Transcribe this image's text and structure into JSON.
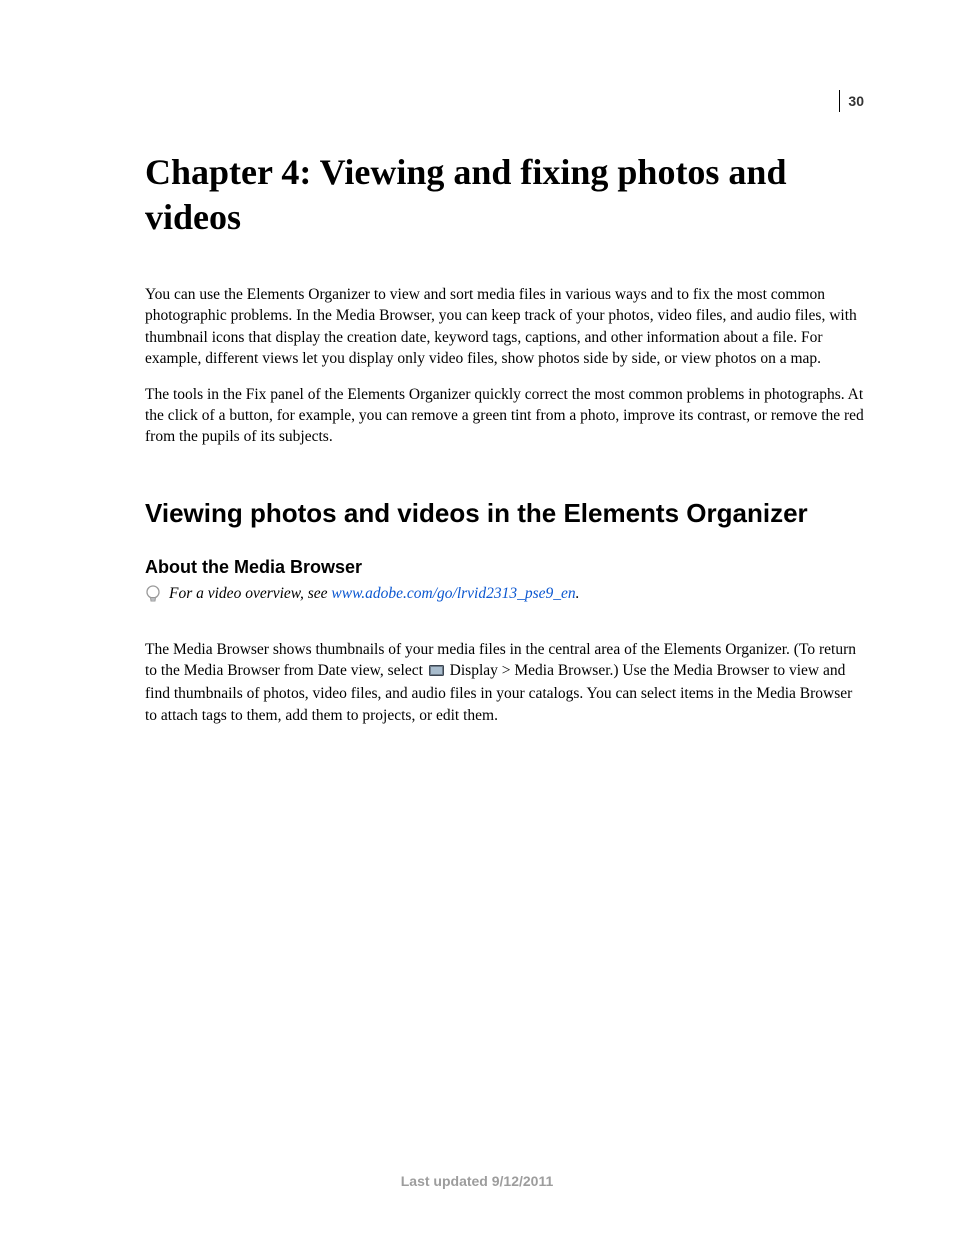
{
  "page_number": "30",
  "chapter_title": "Chapter 4: Viewing and fixing photos and videos",
  "intro_paragraph_1": "You can use the Elements Organizer to view and sort media files in various ways and to fix the most common photographic problems. In the Media Browser, you can keep track of your photos, video files, and audio files, with thumbnail icons that display the creation date, keyword tags, captions, and other information about a file. For example, different views let you display only video files, show photos side by side, or view photos on a map.",
  "intro_paragraph_2": "The tools in the Fix panel of the Elements Organizer quickly correct the most common problems in photographs. At the click of a button, for example, you can remove a green tint from a photo, improve its contrast, or remove the red from the pupils of its subjects.",
  "section_title": "Viewing photos and videos in the Elements Organizer",
  "subsection_title": "About the Media Browser",
  "tip_prefix": "For a video overview, see ",
  "tip_link_text": "www.adobe.com/go/lrvid2313_pse9_en",
  "tip_suffix": ".",
  "body_p1_part1": "The Media Browser shows thumbnails of your media files in the central area of the Elements Organizer. (To return to the Media Browser from Date view, select ",
  "body_p1_part2": " Display > Media Browser.) Use the Media Browser to view and find thumbnails of photos, video files, and audio files in your catalogs. You can select items in the Media Browser to attach tags to them, add them to projects, or edit them.",
  "footer_text": "Last updated 9/12/2011"
}
